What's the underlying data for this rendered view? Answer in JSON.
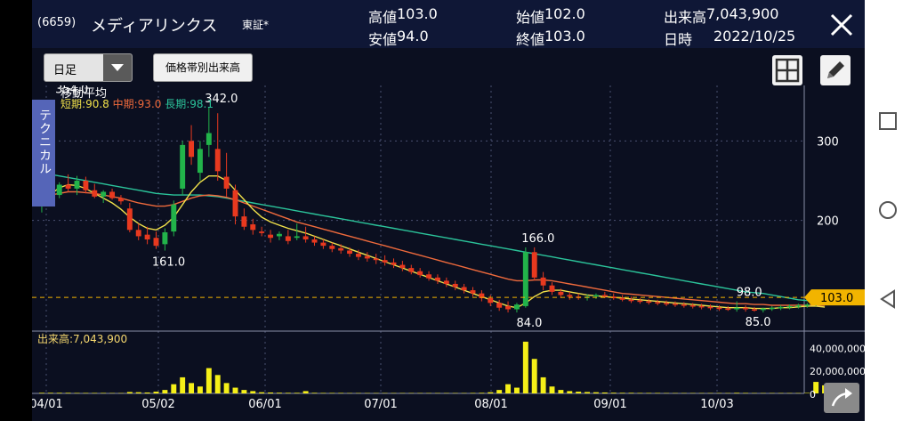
{
  "header": {
    "code": "(6659)",
    "name": "メディアリンクス",
    "market": "東証*",
    "high_label": "高値",
    "high": "103.0",
    "low_label": "安値",
    "low": "94.0",
    "open_label": "始値",
    "open": "102.0",
    "close_label": "終値",
    "close": "103.0",
    "volume_label": "出来高",
    "volume": "7,043,900",
    "date_label": "日時",
    "date": "2022/10/25"
  },
  "toolbar": {
    "period": "日足",
    "vp_button": "価格帯別出来高"
  },
  "side_tab": "テクニカル",
  "ma": {
    "title": "移動平均",
    "short_label": "短期",
    "short": "90.8",
    "mid_label": "中期",
    "mid": "93.0",
    "long_label": "長期",
    "long": "98.1"
  },
  "volume_panel": {
    "label": "出来高:7,043,900"
  },
  "colors": {
    "up": "#22b34a",
    "down": "#e8391f",
    "ma_short": "#f0e04a",
    "ma_mid": "#ef6a3c",
    "ma_long": "#2bc39a",
    "volume": "#f5ef18",
    "price_tag": "#f2b400",
    "header_bg": "#0f1736",
    "chart_bg": "#0b0f20"
  },
  "chart_data": {
    "type": "candlestick",
    "x_ticks": [
      "04/01",
      "05/02",
      "06/01",
      "07/01",
      "08/01",
      "09/01",
      "10/03"
    ],
    "y_ticks": [
      "300",
      "200"
    ],
    "volume_ticks": [
      "40,000,000",
      "20,000,000",
      "0"
    ],
    "price_tag": "103.0",
    "annotations": [
      "354.0",
      "342.0",
      "161.0",
      "166.0",
      "84.0",
      "98.0",
      "85.0"
    ],
    "price_range": [
      65,
      370
    ],
    "candles_ohlc": [
      [
        220,
        228,
        210,
        225
      ],
      [
        225,
        238,
        220,
        232
      ],
      [
        232,
        248,
        228,
        245
      ],
      [
        245,
        258,
        236,
        240
      ],
      [
        240,
        256,
        232,
        250
      ],
      [
        250,
        255,
        234,
        238
      ],
      [
        238,
        246,
        228,
        230
      ],
      [
        230,
        238,
        222,
        236
      ],
      [
        236,
        240,
        226,
        228
      ],
      [
        228,
        232,
        220,
        224
      ],
      [
        215,
        222,
        185,
        188
      ],
      [
        188,
        196,
        175,
        180
      ],
      [
        182,
        192,
        170,
        176
      ],
      [
        178,
        186,
        164,
        168
      ],
      [
        170,
        190,
        162,
        185
      ],
      [
        186,
        225,
        180,
        220
      ],
      [
        240,
        300,
        232,
        295
      ],
      [
        300,
        320,
        270,
        280
      ],
      [
        260,
        300,
        250,
        290
      ],
      [
        295,
        342,
        280,
        310
      ],
      [
        290,
        335,
        250,
        262
      ],
      [
        255,
        285,
        230,
        240
      ],
      [
        238,
        245,
        195,
        205
      ],
      [
        205,
        215,
        188,
        192
      ],
      [
        195,
        202,
        182,
        188
      ],
      [
        186,
        192,
        180,
        184
      ],
      [
        182,
        188,
        172,
        178
      ],
      [
        180,
        186,
        175,
        183
      ],
      [
        180,
        188,
        170,
        174
      ],
      [
        178,
        196,
        175,
        180
      ],
      [
        180,
        192,
        172,
        176
      ],
      [
        176,
        180,
        168,
        172
      ],
      [
        172,
        176,
        164,
        168
      ],
      [
        168,
        172,
        160,
        164
      ],
      [
        165,
        170,
        158,
        162
      ],
      [
        162,
        166,
        154,
        158
      ],
      [
        158,
        163,
        150,
        154
      ],
      [
        155,
        160,
        148,
        152
      ],
      [
        152,
        158,
        145,
        150
      ],
      [
        150,
        156,
        143,
        147
      ],
      [
        147,
        152,
        140,
        144
      ],
      [
        144,
        149,
        136,
        140
      ],
      [
        140,
        144,
        132,
        135
      ],
      [
        136,
        140,
        128,
        131
      ],
      [
        132,
        136,
        124,
        127
      ],
      [
        128,
        132,
        120,
        124
      ],
      [
        124,
        128,
        116,
        120
      ],
      [
        120,
        124,
        112,
        116
      ],
      [
        116,
        120,
        108,
        112
      ],
      [
        112,
        116,
        104,
        108
      ],
      [
        108,
        112,
        98,
        102
      ],
      [
        102,
        106,
        92,
        96
      ],
      [
        96,
        100,
        86,
        90
      ],
      [
        92,
        98,
        84,
        88
      ],
      [
        88,
        96,
        84,
        94
      ],
      [
        92,
        166,
        90,
        160
      ],
      [
        160,
        166,
        124,
        128
      ],
      [
        128,
        135,
        112,
        118
      ],
      [
        118,
        122,
        106,
        110
      ],
      [
        110,
        114,
        102,
        106
      ],
      [
        106,
        110,
        100,
        104
      ],
      [
        104,
        108,
        100,
        103
      ],
      [
        103,
        107,
        99,
        104
      ],
      [
        104,
        108,
        101,
        106
      ],
      [
        106,
        110,
        102,
        104
      ],
      [
        104,
        108,
        100,
        102
      ],
      [
        102,
        106,
        98,
        100
      ],
      [
        100,
        104,
        96,
        99
      ],
      [
        99,
        102,
        95,
        98
      ],
      [
        98,
        101,
        94,
        97
      ],
      [
        97,
        100,
        93,
        96
      ],
      [
        96,
        99,
        92,
        95
      ],
      [
        95,
        98,
        91,
        94
      ],
      [
        94,
        97,
        90,
        93
      ],
      [
        93,
        96,
        89,
        92
      ],
      [
        92,
        95,
        88,
        91
      ],
      [
        91,
        94,
        87,
        90
      ],
      [
        90,
        93,
        86,
        89
      ],
      [
        89,
        92,
        86,
        88
      ],
      [
        88,
        98,
        85,
        90
      ],
      [
        90,
        93,
        85,
        88
      ],
      [
        88,
        91,
        85,
        87
      ],
      [
        87,
        90,
        84,
        89
      ],
      [
        89,
        92,
        86,
        90
      ],
      [
        90,
        93,
        87,
        91
      ],
      [
        91,
        94,
        88,
        92
      ],
      [
        92,
        95,
        89,
        93
      ],
      [
        93,
        96,
        90,
        94
      ],
      [
        94,
        98,
        92,
        96
      ],
      [
        102,
        103,
        94,
        103
      ]
    ],
    "ma_short": [
      225,
      233,
      241,
      245,
      244,
      240,
      234,
      228,
      222,
      214,
      204,
      196,
      190,
      188,
      194,
      204,
      220,
      236,
      248,
      256,
      256,
      250,
      238,
      226,
      214,
      204,
      198,
      194,
      190,
      187,
      184,
      180,
      176,
      172,
      168,
      164,
      160,
      156,
      152,
      148,
      144,
      140,
      136,
      132,
      128,
      124,
      120,
      116,
      112,
      108,
      104,
      100,
      96,
      92,
      90,
      96,
      104,
      110,
      112,
      112,
      110,
      108,
      106,
      105,
      104,
      103,
      102,
      101,
      100,
      99,
      98,
      97,
      96,
      95,
      94,
      93,
      92,
      91,
      90,
      90,
      90,
      89,
      89,
      89,
      90,
      90,
      91,
      92,
      92,
      90.8
    ],
    "ma_mid": [
      230,
      232,
      234,
      236,
      236,
      235,
      234,
      232,
      230,
      228,
      225,
      222,
      220,
      218,
      218,
      220,
      224,
      228,
      231,
      232,
      231,
      229,
      226,
      222,
      218,
      214,
      210,
      206,
      202,
      198,
      195,
      192,
      189,
      186,
      183,
      180,
      177,
      174,
      171,
      168,
      165,
      162,
      159,
      156,
      153,
      150,
      147,
      144,
      141,
      138,
      135,
      132,
      129,
      126,
      124,
      124,
      125,
      125,
      124,
      122,
      120,
      118,
      116,
      114,
      112,
      110,
      108,
      107,
      106,
      105,
      104,
      103,
      102,
      101,
      100,
      99,
      98,
      97,
      96,
      95,
      95,
      94,
      94,
      93,
      93,
      93,
      93,
      93,
      93,
      93.0
    ],
    "ma_long": [
      260,
      258,
      256,
      254,
      252,
      250,
      248,
      246,
      244,
      242,
      240,
      238,
      236,
      234,
      233,
      232,
      232,
      232,
      232,
      231,
      230,
      228,
      226,
      224,
      222,
      220,
      218,
      216,
      214,
      212,
      210,
      208,
      206,
      204,
      202,
      200,
      198,
      196,
      194,
      192,
      190,
      188,
      186,
      184,
      182,
      180,
      178,
      176,
      174,
      172,
      170,
      168,
      166,
      164,
      162,
      160,
      158,
      156,
      154,
      152,
      150,
      148,
      146,
      144,
      142,
      140,
      138,
      136,
      134,
      132,
      130,
      128,
      126,
      124,
      122,
      120,
      118,
      116,
      114,
      112,
      110,
      109,
      108,
      106,
      104,
      102,
      100,
      99,
      98.5,
      98.1
    ],
    "volume_m": [
      0.5,
      0.5,
      0.5,
      0.5,
      0.4,
      0.4,
      0.4,
      0.4,
      0.3,
      0.3,
      1.2,
      1.0,
      0.8,
      1.5,
      3.0,
      8.0,
      14.0,
      9.0,
      6.0,
      22.0,
      16.0,
      9.0,
      5.0,
      3.0,
      2.0,
      1.0,
      0.8,
      0.6,
      0.5,
      0.5,
      2.0,
      0.5,
      0.4,
      0.4,
      0.4,
      0.3,
      0.3,
      0.3,
      0.3,
      0.3,
      0.3,
      0.3,
      0.3,
      0.3,
      0.3,
      0.3,
      0.3,
      0.3,
      0.3,
      0.4,
      0.5,
      1.0,
      3.0,
      8.0,
      5.0,
      45.0,
      30.0,
      14.0,
      6.0,
      3.0,
      2.0,
      1.5,
      1.2,
      1.0,
      0.8,
      0.6,
      0.5,
      0.5,
      0.4,
      0.4,
      0.4,
      0.3,
      0.3,
      0.3,
      0.3,
      0.3,
      0.3,
      0.3,
      0.3,
      0.5,
      0.4,
      0.3,
      0.3,
      0.3,
      0.3,
      0.3,
      0.3,
      0.4,
      10.0,
      7.04
    ]
  }
}
